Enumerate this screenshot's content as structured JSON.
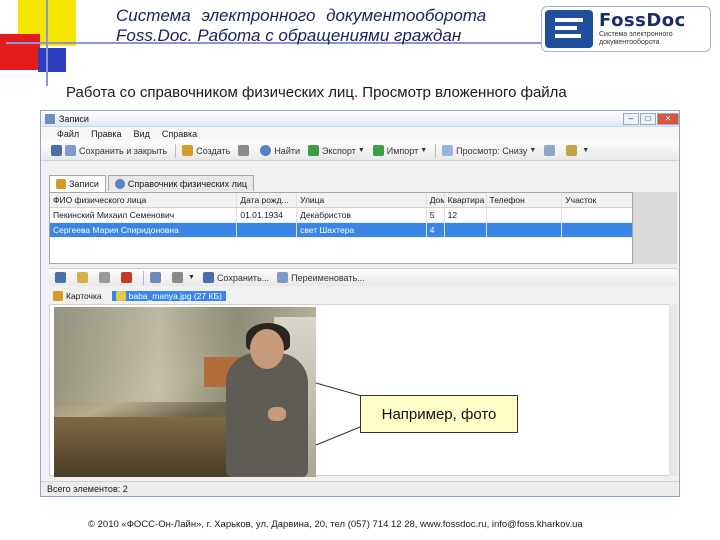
{
  "slide": {
    "title_line1": "Система электронного документооборота",
    "title_line2": "Foss.Doc. Работа с обращениями граждан",
    "subtitle": "Работа со справочником физических лиц. Просмотр вложенного файла",
    "footer": "© 2010 «ФОСС-Он-Лайн», г. Харьков, ул. Дарвина, 20, тел (057) 714 12 28, www.fossdoc.ru, info@foss.kharkov.ua",
    "accent_colors": {
      "yellow": "#f6e600",
      "red": "#e31b1b",
      "blue": "#2d3fbf"
    }
  },
  "logo": {
    "brand": "FossDoc",
    "sub_line1": "Система электронного",
    "sub_line2": "документооборота"
  },
  "window": {
    "title": "Записи",
    "menu": [
      "Файл",
      "Правка",
      "Вид",
      "Справка"
    ],
    "toolbar": {
      "save_close": "Сохранить и закрыть",
      "create": "Создать",
      "find": "Найти",
      "export": "Экспорт",
      "import": "Импорт",
      "view": "Просмотр: Снизу"
    },
    "tabs": [
      "Записи",
      "Справочник физических лиц"
    ],
    "grid": {
      "headers": [
        "ФИО физического лица",
        "Дата рожд...",
        "Улица",
        "Дом",
        "Квартира",
        "Телефон",
        "Участок"
      ],
      "rows": [
        [
          "Пекинский Михаил Семенович",
          "01.01.1934",
          "Декабристов",
          "5",
          "12",
          "",
          ""
        ],
        [
          "Сергеева Мария Спиридоновна",
          "",
          "свет Шахтера",
          "4",
          "",
          "",
          ""
        ]
      ],
      "selected_row": 1
    },
    "lower_toolbar": {
      "save": "Сохранить...",
      "rename": "Переименовать..."
    },
    "lower_tabs": {
      "card": "Карточка",
      "file": "baba_manya.jpg (27 КБ)"
    },
    "status": "Всего элементов: 2"
  },
  "callout": {
    "text": "Например, фото"
  }
}
